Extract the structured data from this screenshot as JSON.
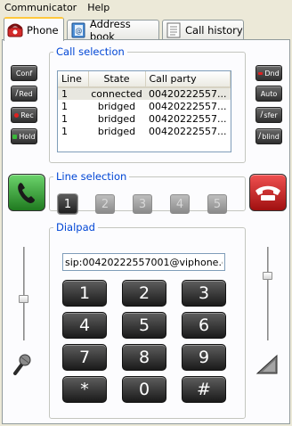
{
  "menu": [
    "Communicator",
    "Help"
  ],
  "tabs": [
    {
      "label": "Phone",
      "icon": "phone-icon"
    },
    {
      "label": "Address book",
      "icon": "address-book-icon"
    },
    {
      "label": "Call history",
      "icon": "call-history-icon"
    }
  ],
  "call_selection": {
    "title": "Call selection",
    "columns": [
      "Line",
      "State",
      "Call party"
    ],
    "rows": [
      {
        "line": "1",
        "state": "connected",
        "party": "00420222557..."
      },
      {
        "line": "1",
        "state": "bridged",
        "party": "00420222557..."
      },
      {
        "line": "1",
        "state": "bridged",
        "party": "00420222557..."
      },
      {
        "line": "1",
        "state": "bridged",
        "party": "00420222557..."
      }
    ]
  },
  "left_buttons": [
    "Conf",
    "Red",
    "Rec",
    "Hold"
  ],
  "right_buttons": [
    "Dnd",
    "Auto",
    "sfer",
    "blind"
  ],
  "line_selection": {
    "title": "Line selection",
    "lines": [
      "1",
      "2",
      "3",
      "4",
      "5"
    ],
    "active": "1"
  },
  "dialpad": {
    "title": "Dialpad",
    "number": "sip:00420222557001@viphone.cz",
    "keys": [
      "1",
      "2",
      "3",
      "4",
      "5",
      "6",
      "7",
      "8",
      "9",
      "*",
      "0",
      "#"
    ]
  },
  "colors": {
    "accent_blue": "#0046d5",
    "call_green": "#2e9b2e",
    "hangup_red": "#c8161b",
    "tab_highlight": "#ffc83c"
  },
  "sliders": {
    "microphone_level": 0.45,
    "speaker_level": 0.7
  }
}
